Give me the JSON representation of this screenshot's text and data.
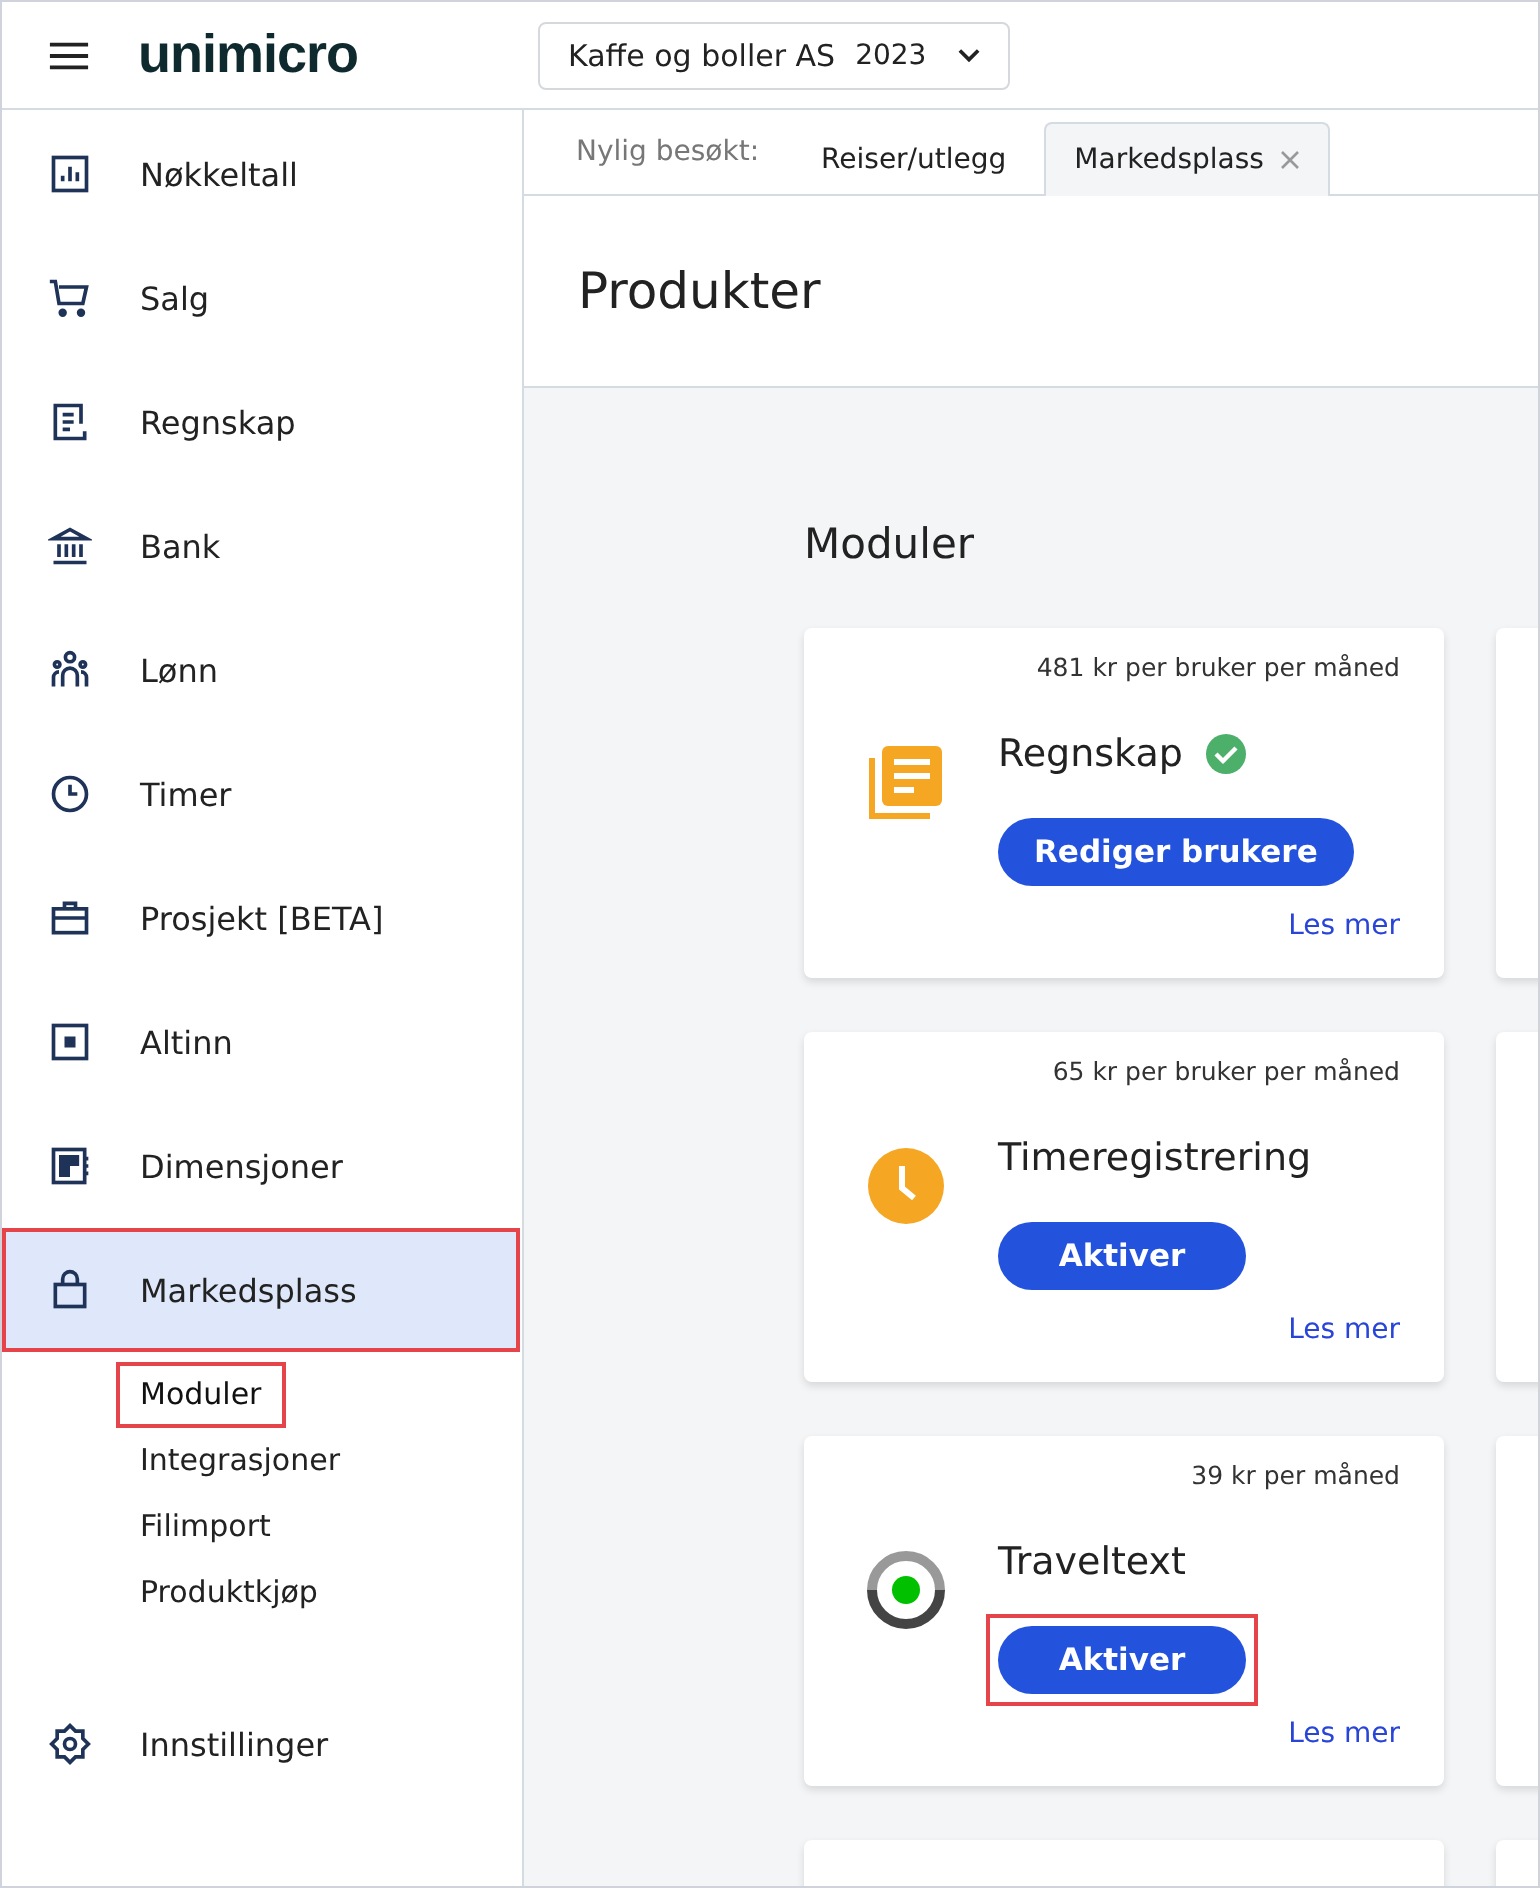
{
  "header": {
    "logo": "unimicro",
    "company": "Kaffe og boller AS",
    "year": "2023"
  },
  "sidebar": {
    "items": [
      {
        "label": "Nøkkeltall",
        "selected": false,
        "highlighted": false
      },
      {
        "label": "Salg",
        "selected": false,
        "highlighted": false
      },
      {
        "label": "Regnskap",
        "selected": false,
        "highlighted": false
      },
      {
        "label": "Bank",
        "selected": false,
        "highlighted": false
      },
      {
        "label": "Lønn",
        "selected": false,
        "highlighted": false
      },
      {
        "label": "Timer",
        "selected": false,
        "highlighted": false
      },
      {
        "label": "Prosjekt [BETA]",
        "selected": false,
        "highlighted": false
      },
      {
        "label": "Altinn",
        "selected": false,
        "highlighted": false
      },
      {
        "label": "Dimensjoner",
        "selected": false,
        "highlighted": false
      },
      {
        "label": "Markedsplass",
        "selected": true,
        "highlighted": true,
        "children": [
          {
            "label": "Moduler",
            "selected": true,
            "highlighted": true
          },
          {
            "label": "Integrasjoner",
            "selected": false,
            "highlighted": false
          },
          {
            "label": "Filimport",
            "selected": false,
            "highlighted": false
          },
          {
            "label": "Produktkjøp",
            "selected": false,
            "highlighted": false
          }
        ]
      },
      {
        "label": "Innstillinger",
        "selected": false,
        "highlighted": false
      }
    ]
  },
  "recent": {
    "label": "Nylig besøkt:",
    "tabs": [
      {
        "label": "Reiser/utlegg",
        "selected": false,
        "closable": false
      },
      {
        "label": "Markedsplass",
        "selected": true,
        "closable": true
      }
    ]
  },
  "page_title": "Produkter",
  "section_title": "Moduler",
  "modules": [
    {
      "price": "481 kr per bruker per måned",
      "name": "Regnskap",
      "active": true,
      "button": "Rediger brukere",
      "highlighted": false,
      "link": "Les mer"
    },
    {
      "price": "65 kr per bruker per måned",
      "name": "Timeregistrering",
      "active": false,
      "button": "Aktiver",
      "highlighted": false,
      "link": "Les mer"
    },
    {
      "price": "39 kr per måned",
      "name": "Traveltext",
      "active": false,
      "button": "Aktiver",
      "highlighted": true,
      "link": "Les mer"
    }
  ]
}
